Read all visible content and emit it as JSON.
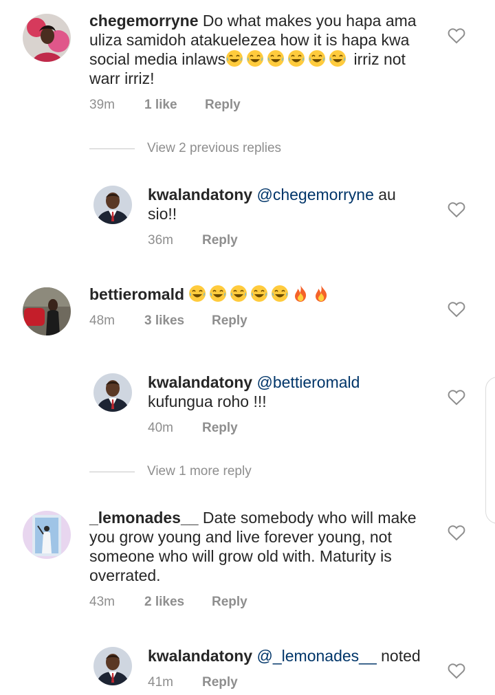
{
  "comments": [
    {
      "username": "chegemorryne",
      "text": "Do what makes you hapa ama uliza samidoh atakuelezea how it is hapa kwa social media inlaws",
      "text_after": " irriz not warr irriz!",
      "time": "39m",
      "likes": "1 like",
      "reply": "Reply"
    },
    {
      "username": "kwalandatony",
      "mention": "@chegemorryne",
      "text": " au sio!!",
      "time": "36m",
      "reply": "Reply"
    },
    {
      "username": "bettieromald",
      "time": "48m",
      "likes": "3 likes",
      "reply": "Reply"
    },
    {
      "username": "kwalandatony",
      "mention": "@bettieromald",
      "text": "kufungua roho !!!",
      "time": "40m",
      "reply": "Reply"
    },
    {
      "username": "_lemonades__",
      "text": " Date somebody who will make you grow young and live forever young, not someone who will grow old with.  Maturity is overrated.",
      "time": "43m",
      "likes": "2 likes",
      "reply": "Reply"
    },
    {
      "username": "kwalandatony",
      "mention": "@_lemonades__",
      "text": " noted",
      "time": "41m",
      "reply": "Reply"
    }
  ],
  "view_replies": [
    "View 2 previous replies",
    "View 1 more reply"
  ],
  "icons": {
    "like": "heart-outline-icon",
    "laugh_emoji": "face-with-tears-of-joy",
    "fire_emoji": "fire"
  },
  "colors": {
    "text": "#262626",
    "meta": "#8e8e8e",
    "mention": "#003569"
  }
}
